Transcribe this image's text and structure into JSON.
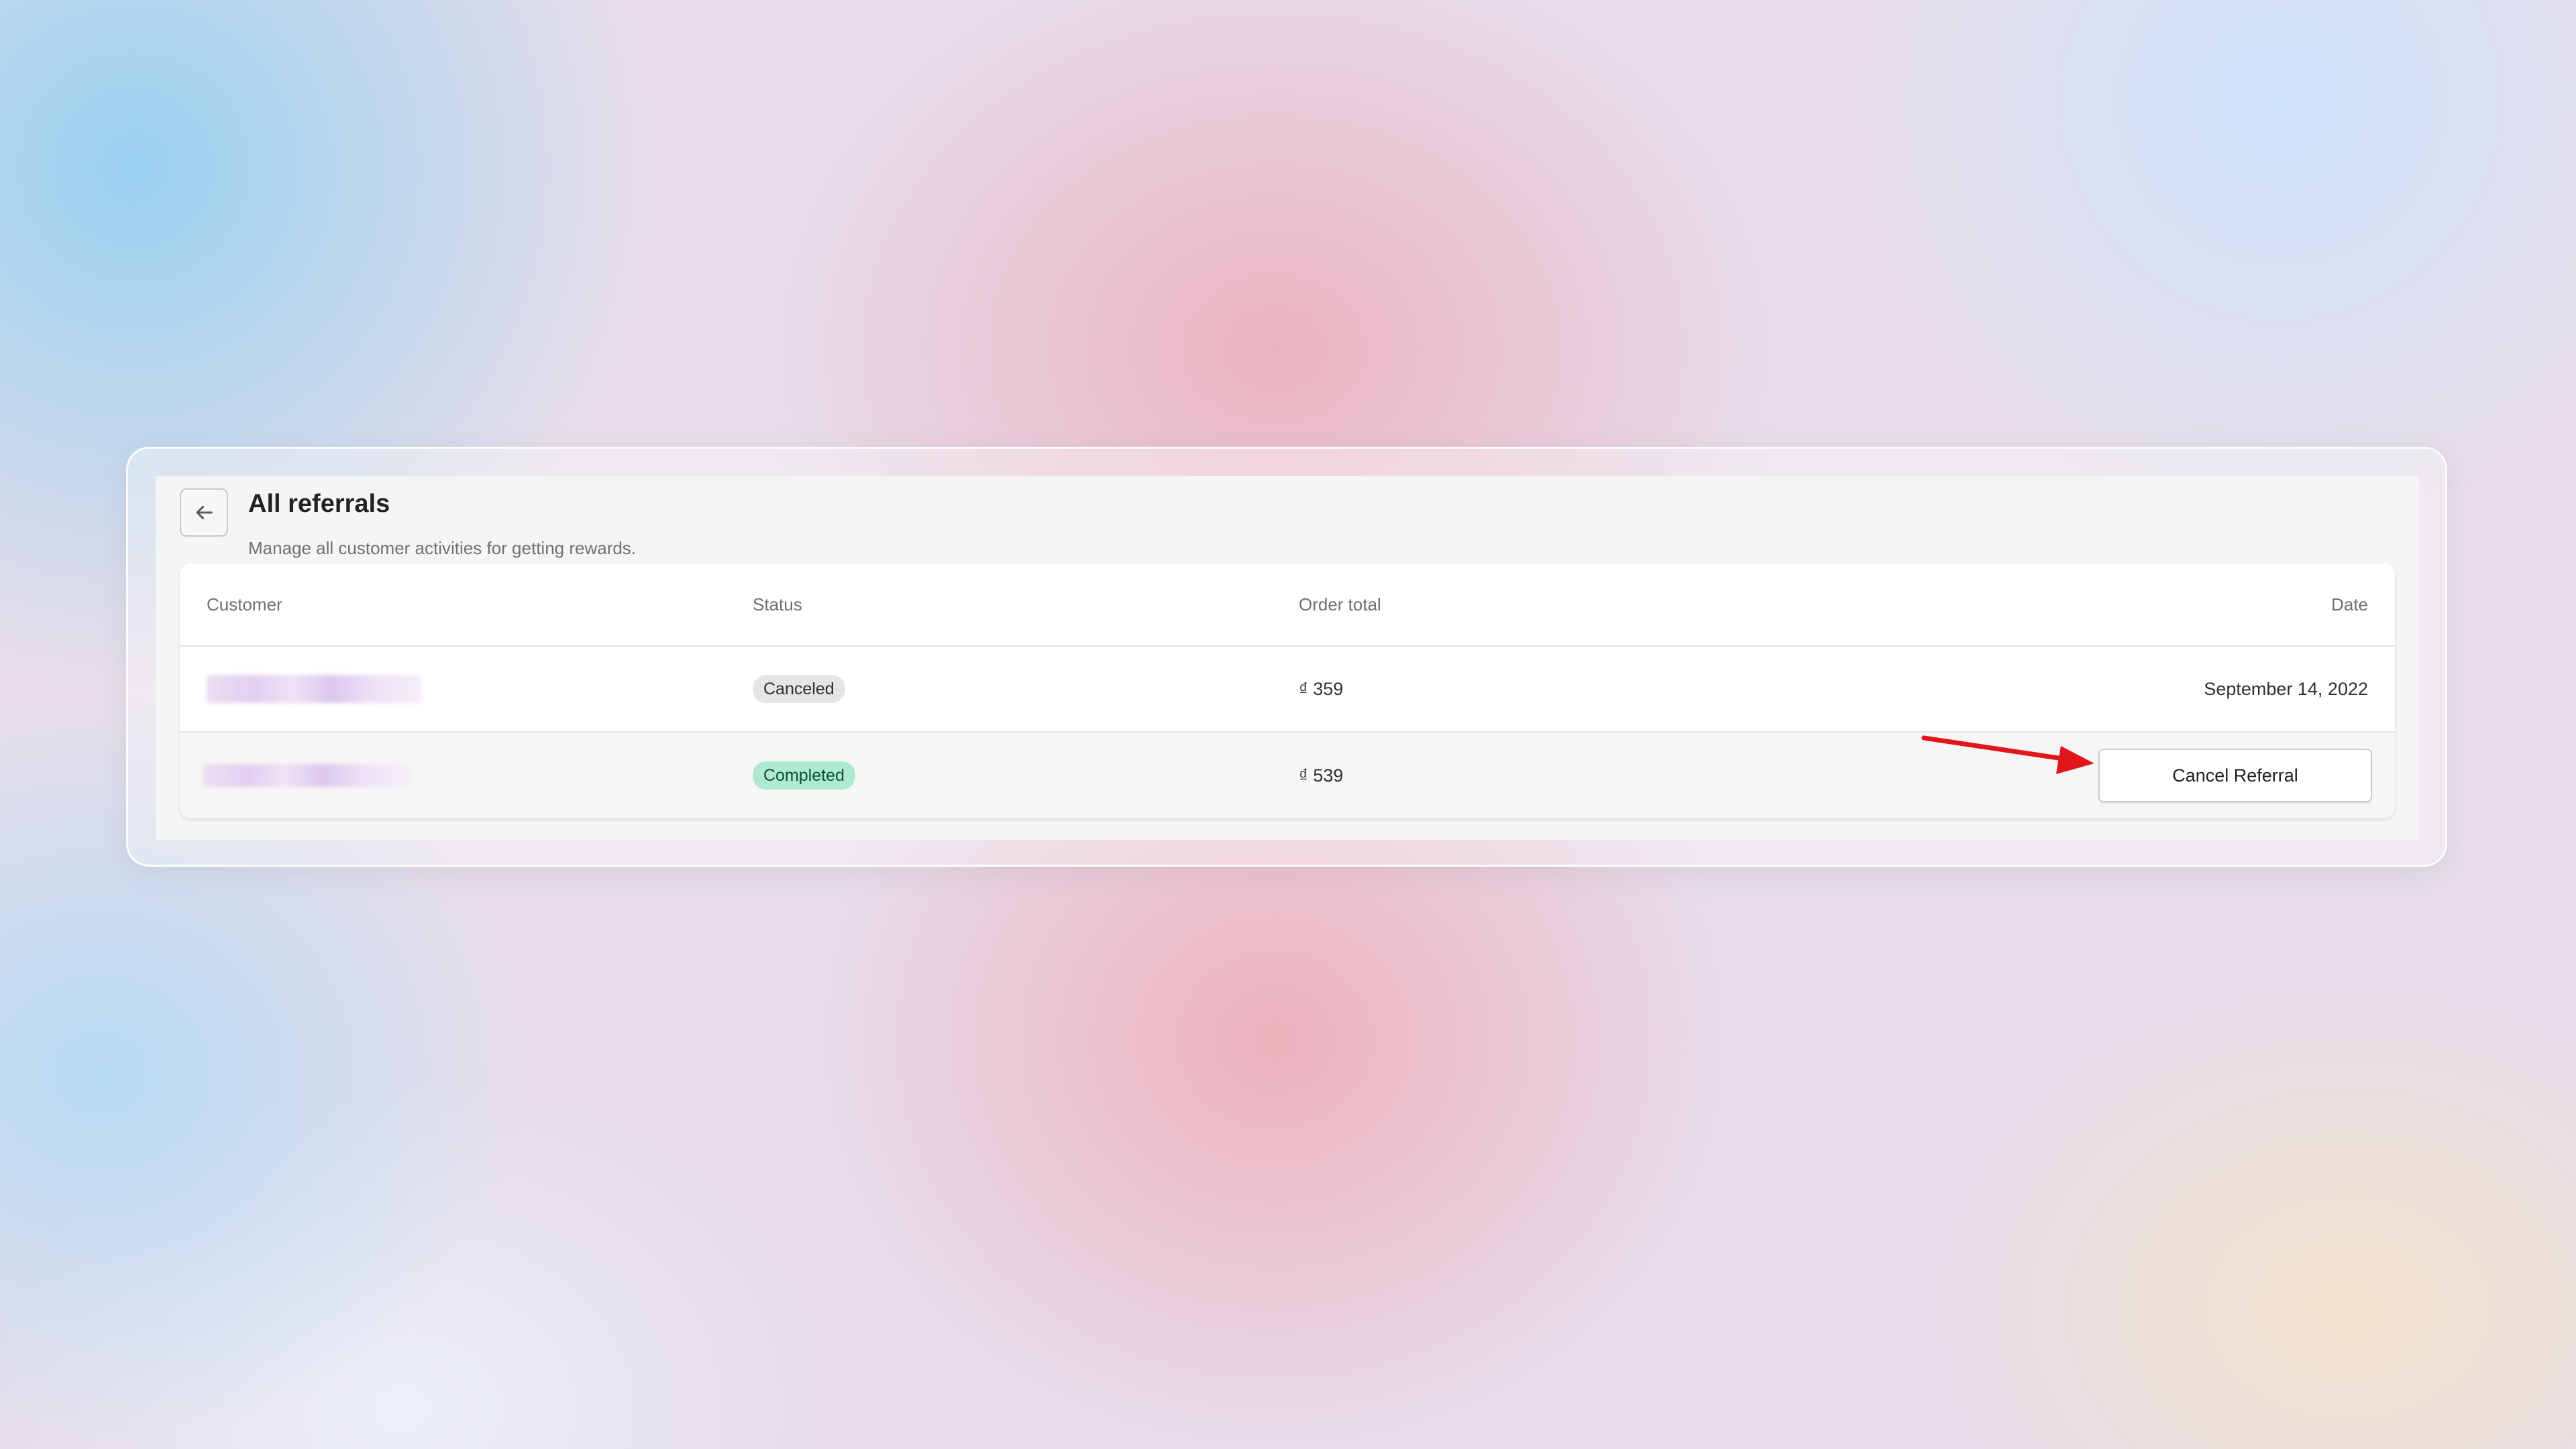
{
  "header": {
    "title": "All referrals",
    "subtitle": "Manage all customer activities for getting rewards."
  },
  "table": {
    "columns": {
      "customer": "Customer",
      "status": "Status",
      "order_total": "Order total",
      "date": "Date"
    },
    "rows": [
      {
        "status": "Canceled",
        "order_total": "₫ 359",
        "date": "September 14, 2022"
      },
      {
        "status": "Completed",
        "order_total": "₫ 539",
        "action_label": "Cancel Referral"
      }
    ]
  },
  "icons": {
    "back": "arrow-left-icon",
    "annotation": "red-arrow-icon"
  },
  "colors": {
    "badge_canceled": "#e4e5e7",
    "badge_completed": "#aee9d1",
    "annotation_arrow": "#e0161b"
  }
}
